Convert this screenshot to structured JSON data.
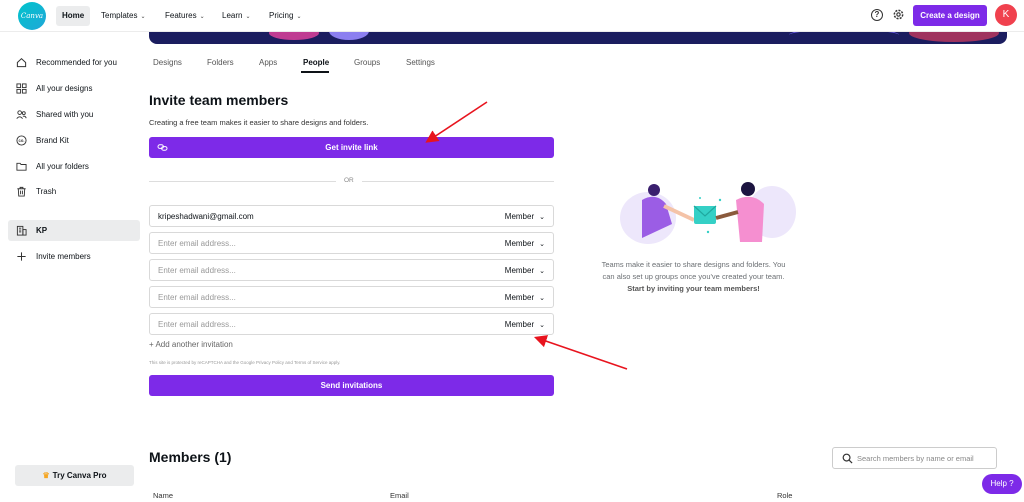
{
  "nav": {
    "logo_text": "Canva",
    "items": [
      {
        "label": "Home",
        "has_chevron": false,
        "active": true
      },
      {
        "label": "Templates",
        "has_chevron": true,
        "active": false
      },
      {
        "label": "Features",
        "has_chevron": true,
        "active": false
      },
      {
        "label": "Learn",
        "has_chevron": true,
        "active": false
      },
      {
        "label": "Pricing",
        "has_chevron": true,
        "active": false
      }
    ],
    "chevron": "⌄",
    "help_icon": "?",
    "create_button": "Create a design",
    "avatar_initial": "K"
  },
  "sidebar": {
    "items": [
      {
        "label": "Recommended for you",
        "icon": "home-icon"
      },
      {
        "label": "All your designs",
        "icon": "grid-icon"
      },
      {
        "label": "Shared with you",
        "icon": "users-icon"
      },
      {
        "label": "Brand Kit",
        "icon": "brand-kit-icon"
      },
      {
        "label": "All your folders",
        "icon": "folder-icon"
      },
      {
        "label": "Trash",
        "icon": "trash-icon"
      }
    ],
    "team": {
      "label": "KP",
      "icon": "building-icon"
    },
    "invite": {
      "label": "Invite members",
      "icon": "plus-icon"
    },
    "try_pro": "Try Canva Pro"
  },
  "tabs": [
    {
      "label": "Designs",
      "active": false
    },
    {
      "label": "Folders",
      "active": false
    },
    {
      "label": "Apps",
      "active": false
    },
    {
      "label": "People",
      "active": true
    },
    {
      "label": "Groups",
      "active": false
    },
    {
      "label": "Settings",
      "active": false
    }
  ],
  "invite": {
    "title": "Invite team members",
    "subtitle": "Creating a free team makes it easier to share designs and folders.",
    "get_link_button": "Get invite link",
    "or_text": "OR",
    "rows": [
      {
        "value": "kripeshadwani@gmail.com",
        "placeholder": "",
        "role": "Member"
      },
      {
        "value": "",
        "placeholder": "Enter email address...",
        "role": "Member"
      },
      {
        "value": "",
        "placeholder": "Enter email address...",
        "role": "Member"
      },
      {
        "value": "",
        "placeholder": "Enter email address...",
        "role": "Member"
      },
      {
        "value": "",
        "placeholder": "Enter email address...",
        "role": "Member"
      }
    ],
    "add_another": "+ Add another invitation",
    "recaptcha_text": "This site is protected by reCAPTCHA and the Google Privacy Policy and Terms of Service apply.",
    "send_button": "Send invitations"
  },
  "right_panel": {
    "text": "Teams make it easier to share designs and folders. You can also set up groups once you've created your team.",
    "bold_text": "Start by inviting your team members!"
  },
  "members": {
    "title": "Members (1)",
    "search_placeholder": "Search members by name or email",
    "columns": [
      "Name",
      "Email",
      "Role"
    ]
  },
  "help_button": "Help",
  "colors": {
    "brand_purple": "#7d2ae8",
    "annotation_red": "#e8141e",
    "banner_navy": "#1b1d5f"
  }
}
